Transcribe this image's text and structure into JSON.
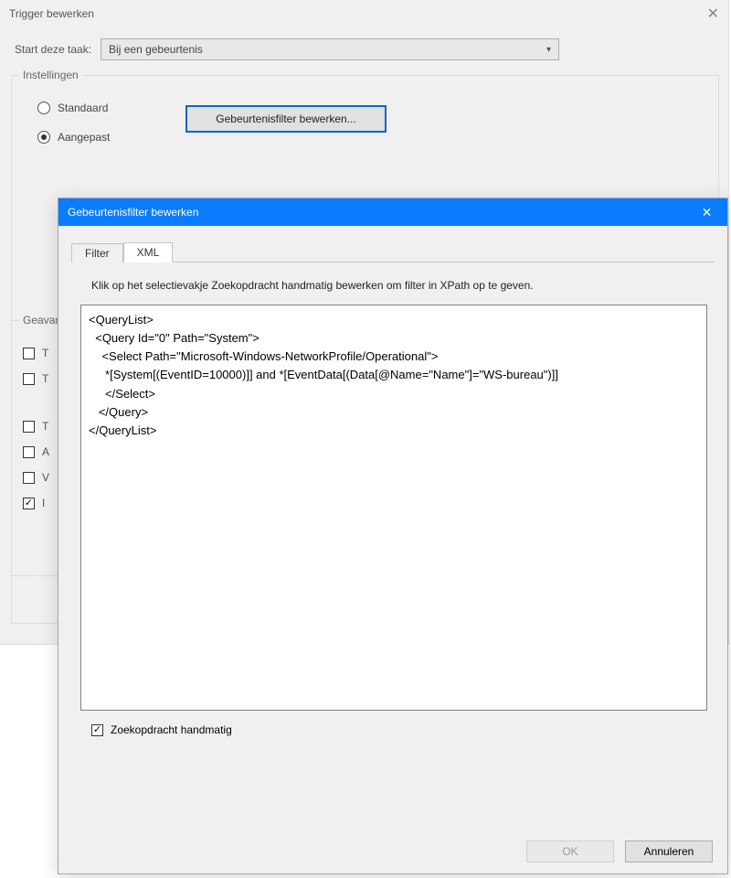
{
  "bg": {
    "title": "Trigger bewerken",
    "close_glyph": "✕",
    "task_label": "Start deze taak:",
    "task_value": "Bij een gebeurtenis",
    "settings_legend": "Instellingen",
    "radio_standard": "Standaard",
    "radio_custom": "Aangepast",
    "filter_button": "Gebeurtenisfilter bewerken...",
    "advanced_legend": "Geavanceerd",
    "check_items": [
      {
        "label": "T",
        "checked": false
      },
      {
        "label": "T",
        "checked": false
      }
    ],
    "check_items2": [
      {
        "label": "T",
        "checked": false
      },
      {
        "label": "A",
        "checked": false
      },
      {
        "label": "V",
        "checked": false
      },
      {
        "label": "I",
        "checked": true
      }
    ]
  },
  "fg": {
    "title": "Gebeurtenisfilter bewerken",
    "close_glyph": "✕",
    "tab_filter": "Filter",
    "tab_xml": "XML",
    "instruction": "Klik op het selectievakje Zoekopdracht handmatig bewerken om filter in XPath op te geven.",
    "xml_text": "<QueryList>\n  <Query Id=\"0\" Path=\"System\">\n    <Select Path=\"Microsoft-Windows-NetworkProfile/Operational\">\n     *[System[(EventID=10000)]] and *[EventData[(Data[@Name=\"Name\"]=\"WS-bureau\")]]\n     </Select>\n   </Query>\n</QueryList>",
    "manual_label": "Zoekopdracht handmatig",
    "manual_checkmark": "✓",
    "ok_label": "OK",
    "cancel_label": "Annuleren"
  }
}
